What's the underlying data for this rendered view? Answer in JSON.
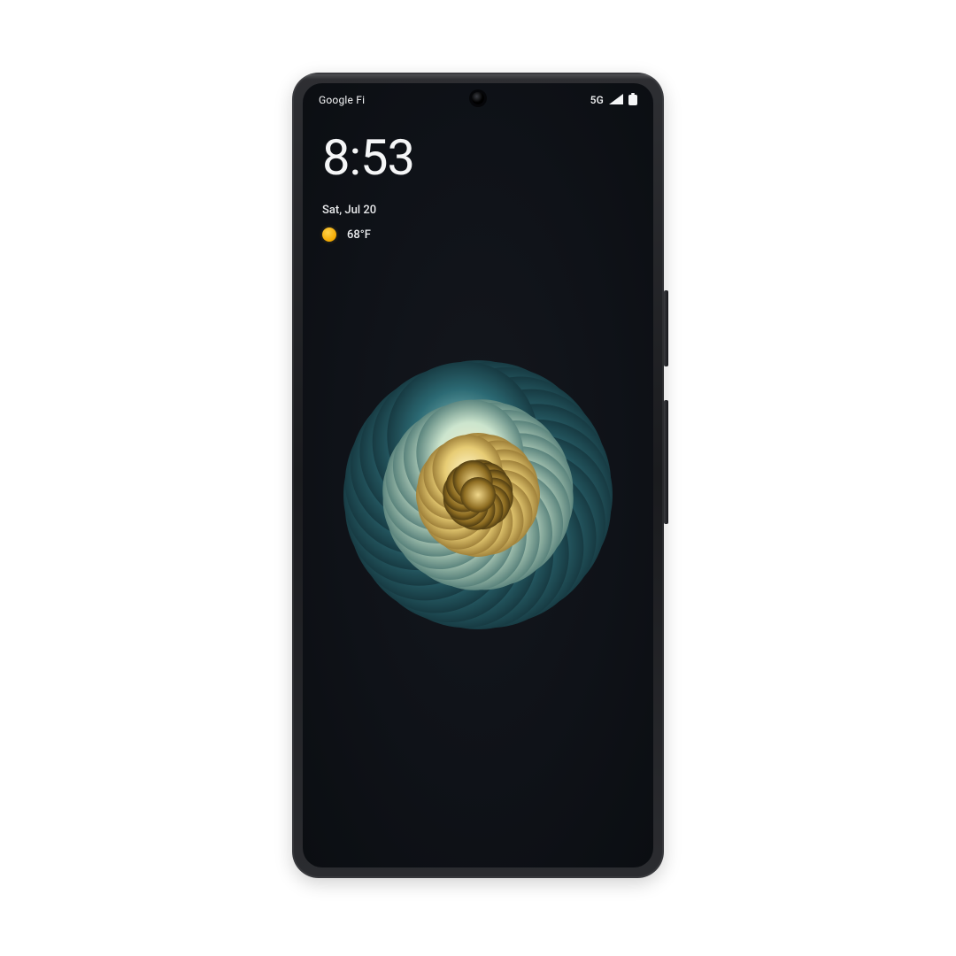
{
  "statusbar": {
    "carrier": "Google Fi",
    "network": "5G"
  },
  "lockscreen": {
    "time": "8:53",
    "date": "Sat, Jul 20",
    "weather_temp": "68°F"
  },
  "wallpaper": {
    "subject": "dahlia-flower"
  }
}
